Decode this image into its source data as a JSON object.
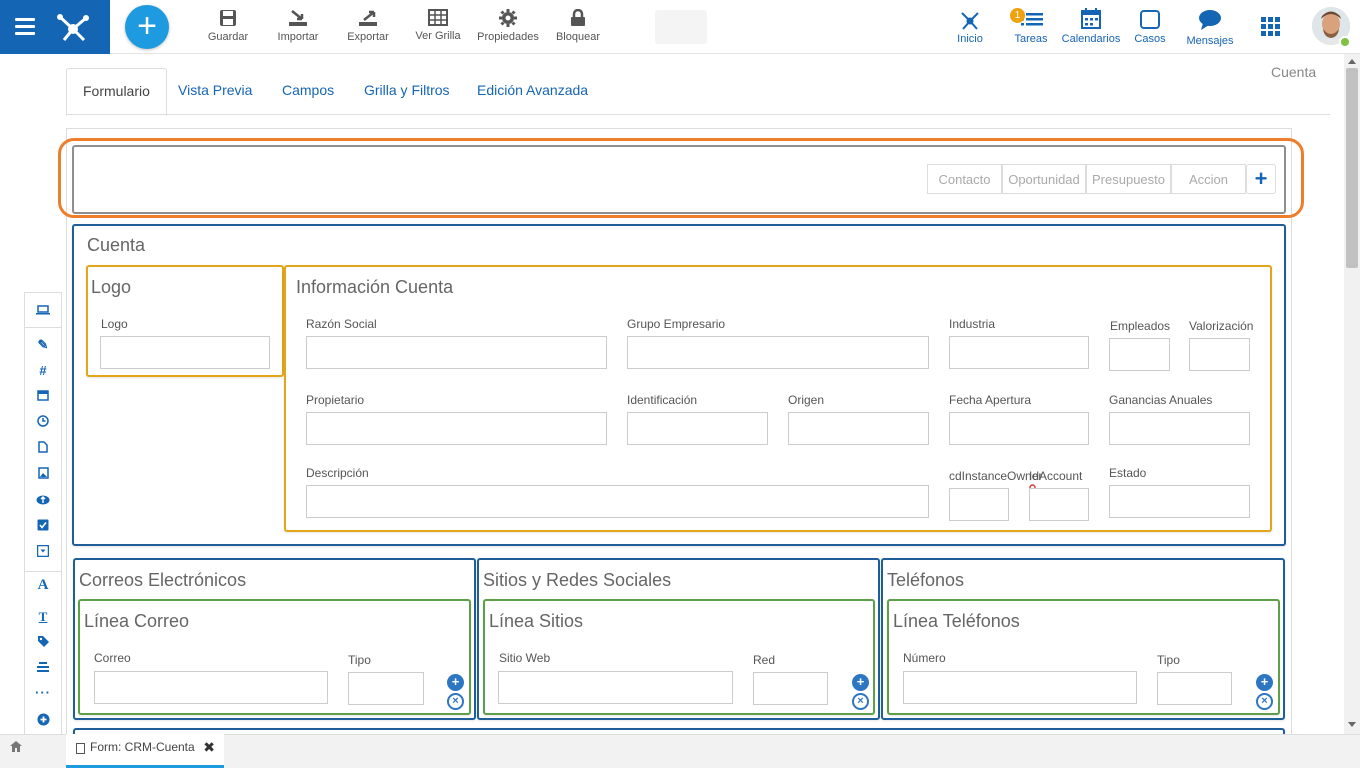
{
  "toolbar": {
    "items": [
      {
        "label": "Guardar",
        "icon": "save-icon"
      },
      {
        "label": "Importar",
        "icon": "import-icon"
      },
      {
        "label": "Exportar",
        "icon": "export-icon"
      },
      {
        "label": "Ver Grilla",
        "icon": "grid-icon"
      },
      {
        "label": "Propiedades",
        "icon": "gear-icon"
      },
      {
        "label": "Bloquear",
        "icon": "lock-icon"
      }
    ]
  },
  "topnav": {
    "inicio": "Inicio",
    "tareas": "Tareas",
    "tareas_badge": "1",
    "calendarios": "Calendarios",
    "casos": "Casos",
    "mensajes": "Mensajes"
  },
  "tabs": [
    "Formulario",
    "Vista Previa",
    "Campos",
    "Grilla y Filtros",
    "Edición Avanzada"
  ],
  "entity_label": "Cuenta",
  "header_links": [
    "Contacto",
    "Oportunidad",
    "Presupuesto",
    "Accion"
  ],
  "main_panel": {
    "title": "Cuenta",
    "logo_panel": {
      "title": "Logo",
      "field": "Logo"
    },
    "info_panel": {
      "title": "Información Cuenta",
      "fields": {
        "razon_social": "Razón Social",
        "grupo_empresario": "Grupo Empresario",
        "industria": "Industria",
        "empleados": "Empleados",
        "valorizacion": "Valorización",
        "propietario": "Propietario",
        "identificacion": "Identificación",
        "origen": "Origen",
        "fecha_apertura": "Fecha Apertura",
        "ganancias": "Ganancias Anuales",
        "descripcion": "Descripción",
        "cd_owner": "cdInstanceOwner",
        "id_account": "IdAccount",
        "estado": "Estado"
      }
    }
  },
  "sub_panels": [
    {
      "title": "Correos Electrónicos",
      "inner_title": "Línea Correo",
      "field1": "Correo",
      "field2": "Tipo"
    },
    {
      "title": "Sitios y Redes Sociales",
      "inner_title": "Línea Sitios",
      "field1": "Sitio Web",
      "field2": "Red"
    },
    {
      "title": "Teléfonos",
      "inner_title": "Línea Teléfonos",
      "field1": "Número",
      "field2": "Tipo"
    }
  ],
  "bottom": {
    "doc_tab": "Form: CRM-Cuenta"
  },
  "colors": {
    "brand": "#1565b5",
    "accent": "#1e9be0",
    "highlight": "#ee7d2c",
    "container_border": "#1f5e99",
    "group_border": "#e3a51a",
    "line_border": "#5ea04a"
  }
}
